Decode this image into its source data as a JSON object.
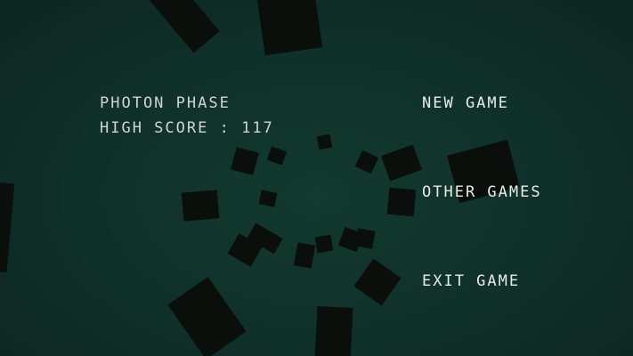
{
  "game": {
    "title": "PHOTON PHASE",
    "high_score_label": "HIGH SCORE :",
    "high_score_value": "117"
  },
  "menu": {
    "new_game": "NEW GAME",
    "other_games": "OTHER GAMES",
    "exit_game": "EXIT GAME"
  },
  "colors": {
    "background": "#10302a",
    "text": "#cfd6cf",
    "tiles": "#0a0f0c"
  }
}
